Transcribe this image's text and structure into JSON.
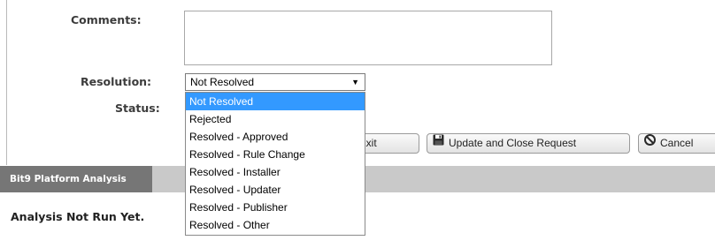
{
  "form": {
    "comments_label": "Comments:",
    "comments_value": "",
    "resolution_label": "Resolution:",
    "resolution_selected": "Not Resolved",
    "status_label": "Status:"
  },
  "dropdown": {
    "options": [
      "Not Resolved",
      "Rejected",
      "Resolved - Approved",
      "Resolved - Rule Change",
      "Resolved - Installer",
      "Resolved - Updater",
      "Resolved - Publisher",
      "Resolved - Other"
    ],
    "highlighted_index": 0
  },
  "buttons": {
    "update_exit": "nd Exit",
    "update_close": "Update and Close Request",
    "cancel": "Cancel"
  },
  "section": {
    "title": "Bit9 Platform Analysis",
    "analysis_status": "Analysis Not Run Yet."
  },
  "icons": {
    "save": "floppy-disk-icon",
    "cancel": "cancel-circle-icon",
    "dropdown": "triangle-down-icon"
  },
  "colors": {
    "highlight": "#3399ff",
    "section_title_bg": "#767676",
    "section_bar_bg": "#c9c9c9"
  }
}
